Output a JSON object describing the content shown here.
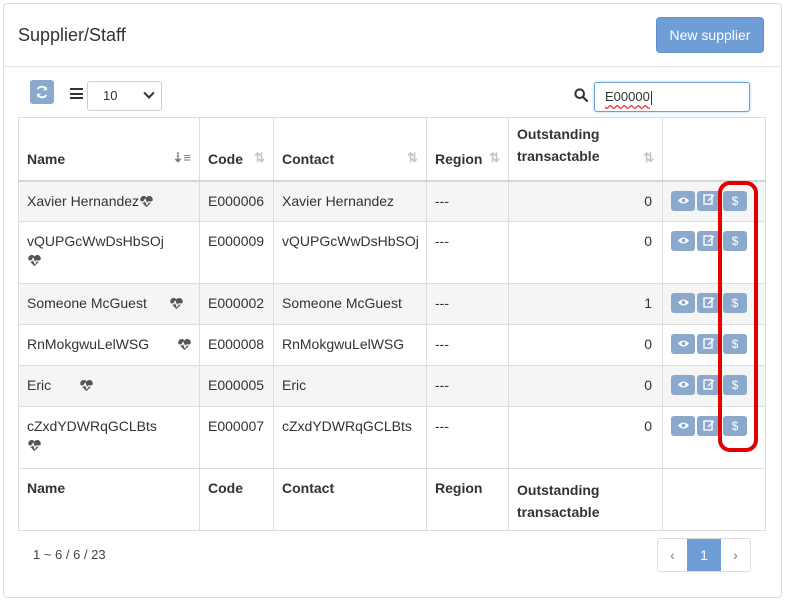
{
  "panel": {
    "title": "Supplier/Staff",
    "new_button": "New supplier"
  },
  "toolbar": {
    "page_size": "10",
    "search_value": "E00000"
  },
  "table": {
    "columns": [
      "Name",
      "Code",
      "Contact",
      "Region",
      "Outstanding transactable"
    ],
    "rows": [
      {
        "name": "Xavier Hernandez",
        "code": "E000006",
        "contact": "Xavier Hernandez",
        "region": "---",
        "outstanding": "0"
      },
      {
        "name": "vQUPGcWwDsHbSOj",
        "code": "E000009",
        "contact": "vQUPGcWwDsHbSOj",
        "region": "---",
        "outstanding": "0"
      },
      {
        "name": "Someone McGuest",
        "code": "E000002",
        "contact": "Someone McGuest",
        "region": "---",
        "outstanding": "1"
      },
      {
        "name": "RnMokgwuLelWSG",
        "code": "E000008",
        "contact": "RnMokgwuLelWSG",
        "region": "---",
        "outstanding": "0"
      },
      {
        "name": "Eric",
        "code": "E000005",
        "contact": "Eric",
        "region": "---",
        "outstanding": "0"
      },
      {
        "name": "cZxdYDWRqGCLBts",
        "code": "E000007",
        "contact": "cZxdYDWRqGCLBts",
        "region": "---",
        "outstanding": "0"
      }
    ],
    "footer_columns": [
      "Name",
      "Code",
      "Contact",
      "Region",
      "Outstanding transactable"
    ]
  },
  "footer": {
    "info": "1 ~ 6 / 6 / 23",
    "prev": "‹",
    "page": "1",
    "next": "›"
  },
  "colors": {
    "accent": "#6f9ed6",
    "action_button": "#8aa9cc",
    "highlight": "#e00000"
  },
  "icons": {
    "refresh": "refresh-icon",
    "list": "list-icon",
    "search": "search-icon",
    "heart": "heartbeat-icon",
    "view": "eye-icon",
    "edit": "edit-icon",
    "pay": "dollar-icon"
  }
}
